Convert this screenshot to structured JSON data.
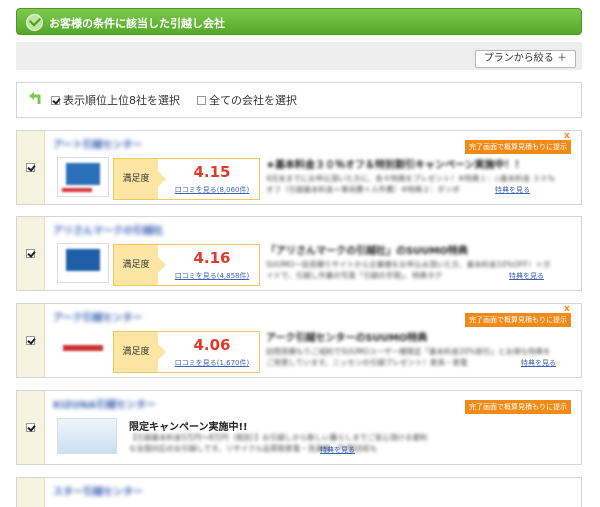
{
  "header": {
    "title": "お客様の条件に該当した引越し会社"
  },
  "plan_bar": {
    "button_label": "プランから絞る ＋"
  },
  "selection": {
    "top8_label": "表示順位上位8社を選択",
    "all_label": "全ての会社を選択"
  },
  "cards": [
    {
      "company": "アート引越センター",
      "badge": "完了画面で概算見積もりに提示",
      "rating_label": "満足度",
      "score": "4.15",
      "reviews_link": "口コミを見る(8,060件)",
      "headline": "★基本料金３０％オフ＆特別割引キャンペーン実施中！！",
      "desc": "4月末までにお申込頂いた方に、各々特典をプレゼント！※特典１：◇基本料金 ３０％オフ（引越基本料金＝車両費＋人件費）※特典２：ダンボ",
      "more": "特典を見る",
      "checked": true
    },
    {
      "company": "アリさんマークの引越社",
      "badge": "完了画面で概算見積もりに提示",
      "rating_label": "満足度",
      "score": "4.16",
      "reviews_link": "口コミを見る(4,858件)",
      "headline": "「アリさんマークの引越社」のSUUMO特典",
      "desc": "SUUMO一括見積りサイトから企業様をお申込み頂いた方、基本料金10%OFF！＋ガイドで、引越し作業の写真「引越の手間」、特典タグ",
      "more": "特典を見る",
      "checked": true
    },
    {
      "company": "アーク引越センター",
      "badge": "完了画面で概算見積もりに提示",
      "rating_label": "満足度",
      "score": "4.06",
      "reviews_link": "口コミを見る(1,670件)",
      "headline": "アーク引越センターのSUUMO特典",
      "desc": "訪問見積もりご成約でSUUMOユーザー様限定「基本料金20%割引」とお得な特典をご用意しています。ニッセンの引越プレゼント！家具・家電",
      "more": "特典を見る",
      "checked": true
    },
    {
      "company": "KIZUNA引越センター",
      "badge": "完了画面で概算見積もりに提示",
      "headline": "限定キャンペーン実施中!!",
      "desc": "【引越基本料金5万円〜8万円（税別）】お引越しから新しい暮らしまでご安心頂ける便利な全国対応のお引越しです。リサイクル品買取家電・洗濯機・TV等回収も",
      "more": "特典を見る",
      "checked": true
    },
    {
      "company": "スター引越センター",
      "checked": true
    }
  ]
}
